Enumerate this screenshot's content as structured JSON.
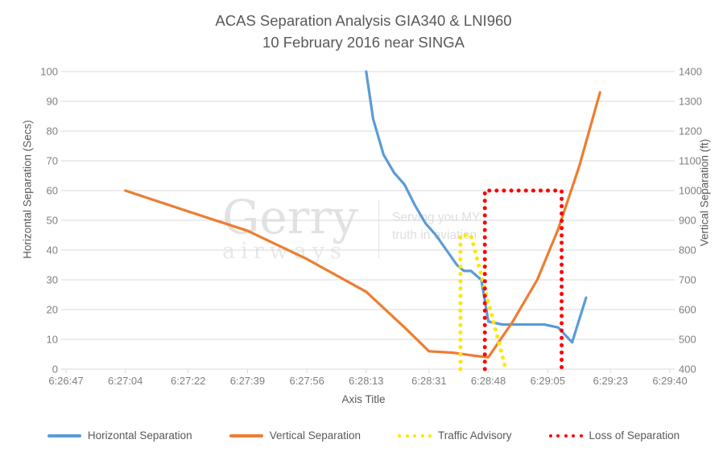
{
  "chart": {
    "title": "ACAS Separation Analysis GIA340 & LNI960\n10 February 2016 near SINGA"
  },
  "watermark": {
    "brand_line1": "Gerry",
    "brand_line2": "airways",
    "tagline": "Serving you MY\ntruth in aviation"
  },
  "chart_data": {
    "type": "line",
    "title": "ACAS Separation Analysis GIA340 & LNI960\n10 February 2016 near SINGA",
    "xlabel": "Axis Title",
    "ylabel": "Horizontal Separation (Secs)",
    "y2label": "Vertical Separation (ft)",
    "grid": true,
    "legend_position": "bottom",
    "xlim": [
      "6:26:47",
      "6:29:40"
    ],
    "xticks": [
      "6:26:47",
      "6:27:04",
      "6:27:22",
      "6:27:39",
      "6:27:56",
      "6:28:13",
      "6:28:31",
      "6:28:48",
      "6:29:05",
      "6:29:23",
      "6:29:40"
    ],
    "ylim": [
      0,
      100
    ],
    "yticks": [
      0,
      10,
      20,
      30,
      40,
      50,
      60,
      70,
      80,
      90,
      100
    ],
    "y2lim": [
      400,
      1400
    ],
    "y2ticks": [
      400,
      500,
      600,
      700,
      800,
      900,
      1000,
      1100,
      1200,
      1300,
      1400
    ],
    "colors": {
      "horizontal_separation": "#5B9BD5",
      "vertical_separation": "#ED7D31",
      "traffic_advisory": "#FFE600",
      "loss_of_separation": "#FF0000"
    },
    "series": [
      {
        "name": "Horizontal Separation",
        "axis": "left",
        "style": "solid",
        "color": "#5B9BD5",
        "x": [
          "6:28:13",
          "6:28:15",
          "6:28:18",
          "6:28:21",
          "6:28:24",
          "6:28:27",
          "6:28:30",
          "6:28:33",
          "6:28:36",
          "6:28:39",
          "6:28:41",
          "6:28:43",
          "6:28:46",
          "6:28:48",
          "6:28:52",
          "6:28:58",
          "6:29:04",
          "6:29:08",
          "6:29:12",
          "6:29:16"
        ],
        "values": [
          100,
          84,
          72,
          66,
          62,
          55,
          49,
          45,
          40,
          35,
          33,
          33,
          30,
          16,
          15,
          15,
          15,
          14,
          9,
          24
        ]
      },
      {
        "name": "Vertical Separation",
        "axis": "right",
        "style": "solid",
        "color": "#ED7D31",
        "x": [
          "6:27:04",
          "6:27:22",
          "6:27:39",
          "6:27:56",
          "6:28:13",
          "6:28:24",
          "6:28:31",
          "6:28:38",
          "6:28:44",
          "6:28:48",
          "6:28:55",
          "6:29:02",
          "6:29:08",
          "6:29:14",
          "6:29:20"
        ],
        "values": [
          1000,
          930,
          865,
          770,
          660,
          540,
          460,
          455,
          445,
          440,
          560,
          700,
          870,
          1080,
          1330
        ]
      },
      {
        "name": "Traffic Advisory",
        "axis": "left",
        "style": "dotted",
        "color": "#FFE600",
        "x": [
          "6:28:40",
          "6:28:40",
          "6:28:43",
          "6:28:53",
          "6:28:53"
        ],
        "values": [
          0,
          45,
          45,
          0,
          0
        ]
      },
      {
        "name": "Loss of Separation",
        "axis": "left",
        "style": "dotted",
        "color": "#FF0000",
        "x": [
          "6:28:47",
          "6:28:47",
          "6:29:09",
          "6:29:09"
        ],
        "values": [
          0,
          60,
          60,
          0
        ]
      }
    ]
  },
  "legend": {
    "items": [
      {
        "label": "Horizontal Separation",
        "color": "#5B9BD5",
        "style": "solid"
      },
      {
        "label": "Vertical Separation",
        "color": "#ED7D31",
        "style": "solid"
      },
      {
        "label": "Traffic Advisory",
        "color": "#FFE600",
        "style": "dotted"
      },
      {
        "label": "Loss of Separation",
        "color": "#FF0000",
        "style": "dotted"
      }
    ]
  }
}
